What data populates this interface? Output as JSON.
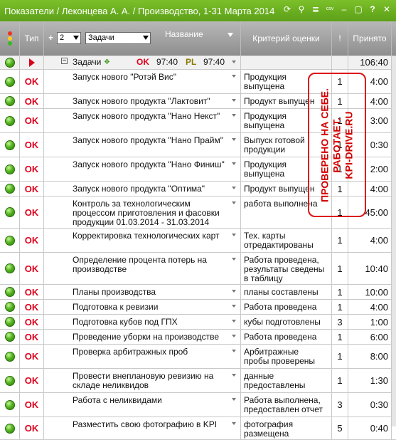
{
  "window": {
    "title": "Показатели / Леконцева А. А. / Производство, 1-31 Марта 2014",
    "icons": [
      "refresh-icon",
      "search-icon",
      "list-icon",
      "csv-icon",
      "minimize-icon",
      "maximize-icon",
      "help-icon",
      "close-icon"
    ],
    "icon_glyphs": [
      "⟳",
      "🔍",
      "≣",
      "csv",
      "–",
      "▢",
      "?",
      "✕"
    ]
  },
  "header": {
    "col_type": "Тип",
    "level_value": "2",
    "filter_value": "Задачи",
    "plus": "+",
    "col_name": "Название",
    "col_criterion": "Критерий оценки",
    "col_excl": "!",
    "col_accepted": "Принято"
  },
  "group": {
    "label": "Задачи",
    "ok": "OK",
    "ok_time": "97:40",
    "pl": "PL",
    "pl_time": "97:40",
    "accepted": "106:40"
  },
  "rows": [
    {
      "type": "OK",
      "name": "Запуск нового \"Ротэй Вис\"",
      "criterion": "Продукция\nвыпущена",
      "excl": "1",
      "accepted": "4:00"
    },
    {
      "type": "OK",
      "name": "Запуск нового продукта \"Лактовит\"",
      "criterion": "Продукт выпущен",
      "excl": "1",
      "accepted": "4:00"
    },
    {
      "type": "OK",
      "name": "Запуск нового продукта \"Нано Некст\"",
      "criterion": "Продукция\nвыпущена",
      "excl": "1",
      "accepted": "3:00"
    },
    {
      "type": "OK",
      "name": "Запуск нового продукта \"Нано Прайм\"",
      "criterion": "Выпуск готовой\nпродукции",
      "excl": "1",
      "accepted": "0:30"
    },
    {
      "type": "OK",
      "name": "Запуск нового продукта \"Нано Финиш\"",
      "criterion": "Продукция\nвыпущена",
      "excl": "1",
      "accepted": "2:00"
    },
    {
      "type": "OK",
      "name": "Запуск нового продукта \"Оптима\"",
      "criterion": "Продукт выпущен",
      "excl": "1",
      "accepted": "4:00"
    },
    {
      "type": "OK",
      "name": "Контроль за технологическим процессом приготовления и фасовки продукции 01.03.2014 - 31.03.2014",
      "criterion": "работа выполнена",
      "excl": "1",
      "accepted": "45:00"
    },
    {
      "type": "OK",
      "name": "Корректировка технологических карт",
      "criterion": "Тех. карты\nотредактированы",
      "excl": "1",
      "accepted": "4:00"
    },
    {
      "type": "OK",
      "name": "Определение процента потерь на производстве",
      "criterion": "Работа проведена,\nрезультаты сведены\nв таблицу",
      "excl": "1",
      "accepted": "10:40"
    },
    {
      "type": "OK",
      "name": "Планы производства",
      "criterion": "планы составлены",
      "excl": "1",
      "accepted": "10:00"
    },
    {
      "type": "OK",
      "name": "Подготовка к ревизии",
      "criterion": "Работа проведена",
      "excl": "1",
      "accepted": "4:00"
    },
    {
      "type": "OK",
      "name": "Подготовка кубов под ГПХ",
      "criterion": "кубы подготовлены",
      "excl": "3",
      "accepted": "1:00"
    },
    {
      "type": "OK",
      "name": "Проведение уборки на производстве",
      "criterion": "Работа проведена",
      "excl": "1",
      "accepted": "6:00"
    },
    {
      "type": "OK",
      "name": "Проверка арбитражных проб",
      "criterion": "Арбитражные\nпробы проверены",
      "excl": "1",
      "accepted": "8:00"
    },
    {
      "type": "OK",
      "name": "Провести внеплановую ревизию на складе неликвидов",
      "criterion": "данные\nпредоставлены",
      "excl": "1",
      "accepted": "1:30"
    },
    {
      "type": "OK",
      "name": "Работа с неликвидами",
      "criterion": "Работа выполнена,\nпредоставлен отчет",
      "excl": "3",
      "accepted": "0:30"
    },
    {
      "type": "OK",
      "name": "Разместить свою фотографию в KPI",
      "criterion": "фотография\nразмещена",
      "excl": "5",
      "accepted": "0:40"
    }
  ],
  "stamp": {
    "line1": "ПРОВЕРЕНО НА СЕБЕ.",
    "line2": "РАБОТАЕТ.",
    "line3": "KPI-DRIVE.RU"
  },
  "colors": {
    "ok": "#e3001b",
    "pl": "#8a7a00",
    "accent": "#6ab023",
    "header": "#9a9a9a"
  }
}
